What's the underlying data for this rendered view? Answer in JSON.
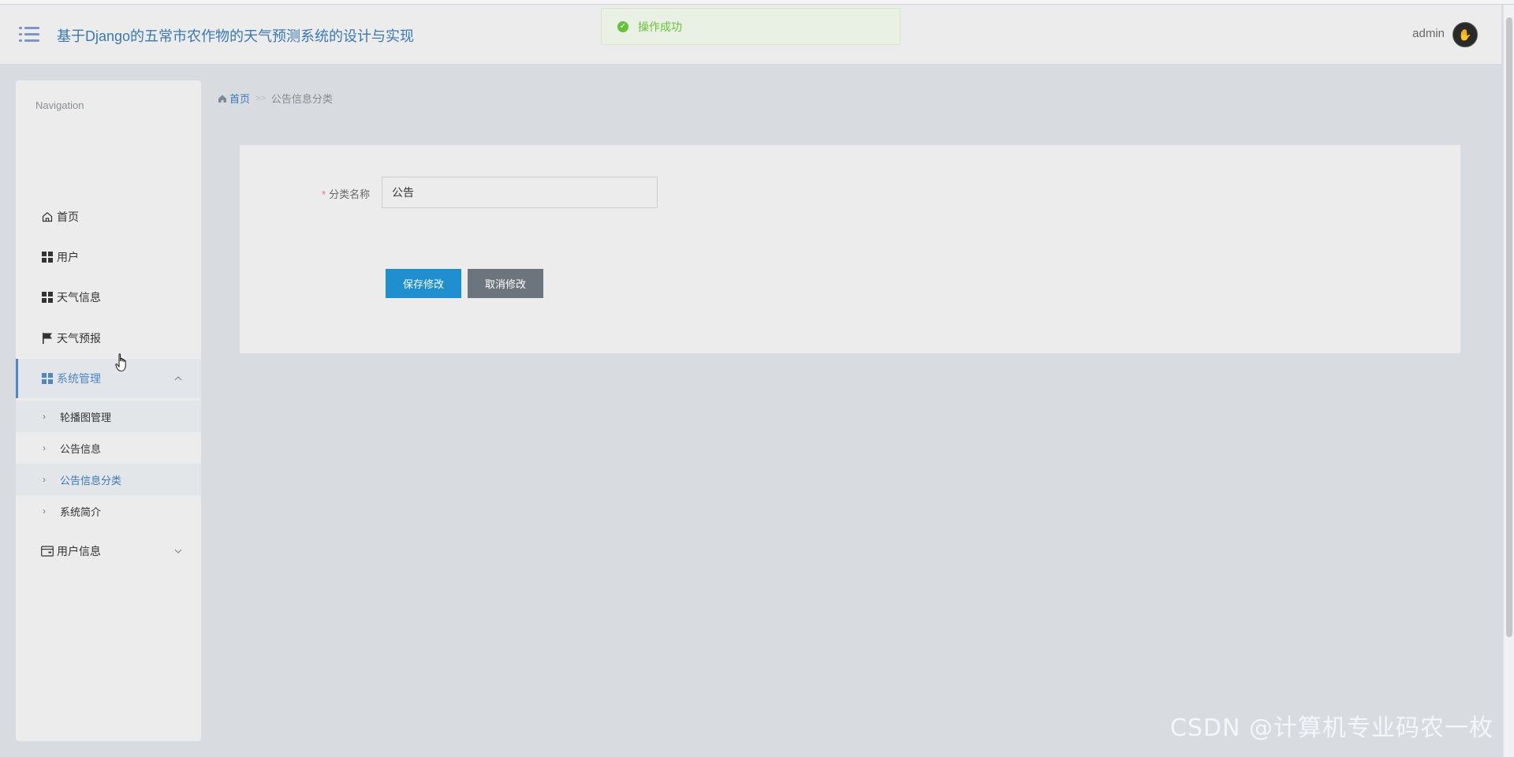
{
  "header": {
    "title": "基于Django的五常市农作物的天气预测系统的设计与实现",
    "username": "admin"
  },
  "toast": {
    "message": "操作成功"
  },
  "sidebar": {
    "heading": "Navigation",
    "items": [
      {
        "label": "首页",
        "icon": "home-icon"
      },
      {
        "label": "用户",
        "icon": "grid-icon"
      },
      {
        "label": "天气信息",
        "icon": "grid-icon"
      },
      {
        "label": "天气预报",
        "icon": "flag-icon"
      },
      {
        "label": "系统管理",
        "icon": "grid-icon",
        "expanded": true
      },
      {
        "label": "用户信息",
        "icon": "wallet-icon",
        "expanded": false
      }
    ],
    "submenu": [
      {
        "label": "轮播图管理"
      },
      {
        "label": "公告信息"
      },
      {
        "label": "公告信息分类"
      },
      {
        "label": "系统简介"
      }
    ]
  },
  "breadcrumb": {
    "home": "首页",
    "separator": ">>",
    "current": "公告信息分类"
  },
  "form": {
    "required_mark": "*",
    "field_label": "分类名称",
    "field_value": "公告",
    "save_label": "保存修改",
    "cancel_label": "取消修改"
  },
  "watermark": "CSDN @计算机专业码农一枚",
  "colors": {
    "accent": "#3a78b3",
    "save_button": "#1f8fcf",
    "cancel_button": "#6c757d",
    "success": "#67c23a",
    "background": "#d8dce1"
  }
}
